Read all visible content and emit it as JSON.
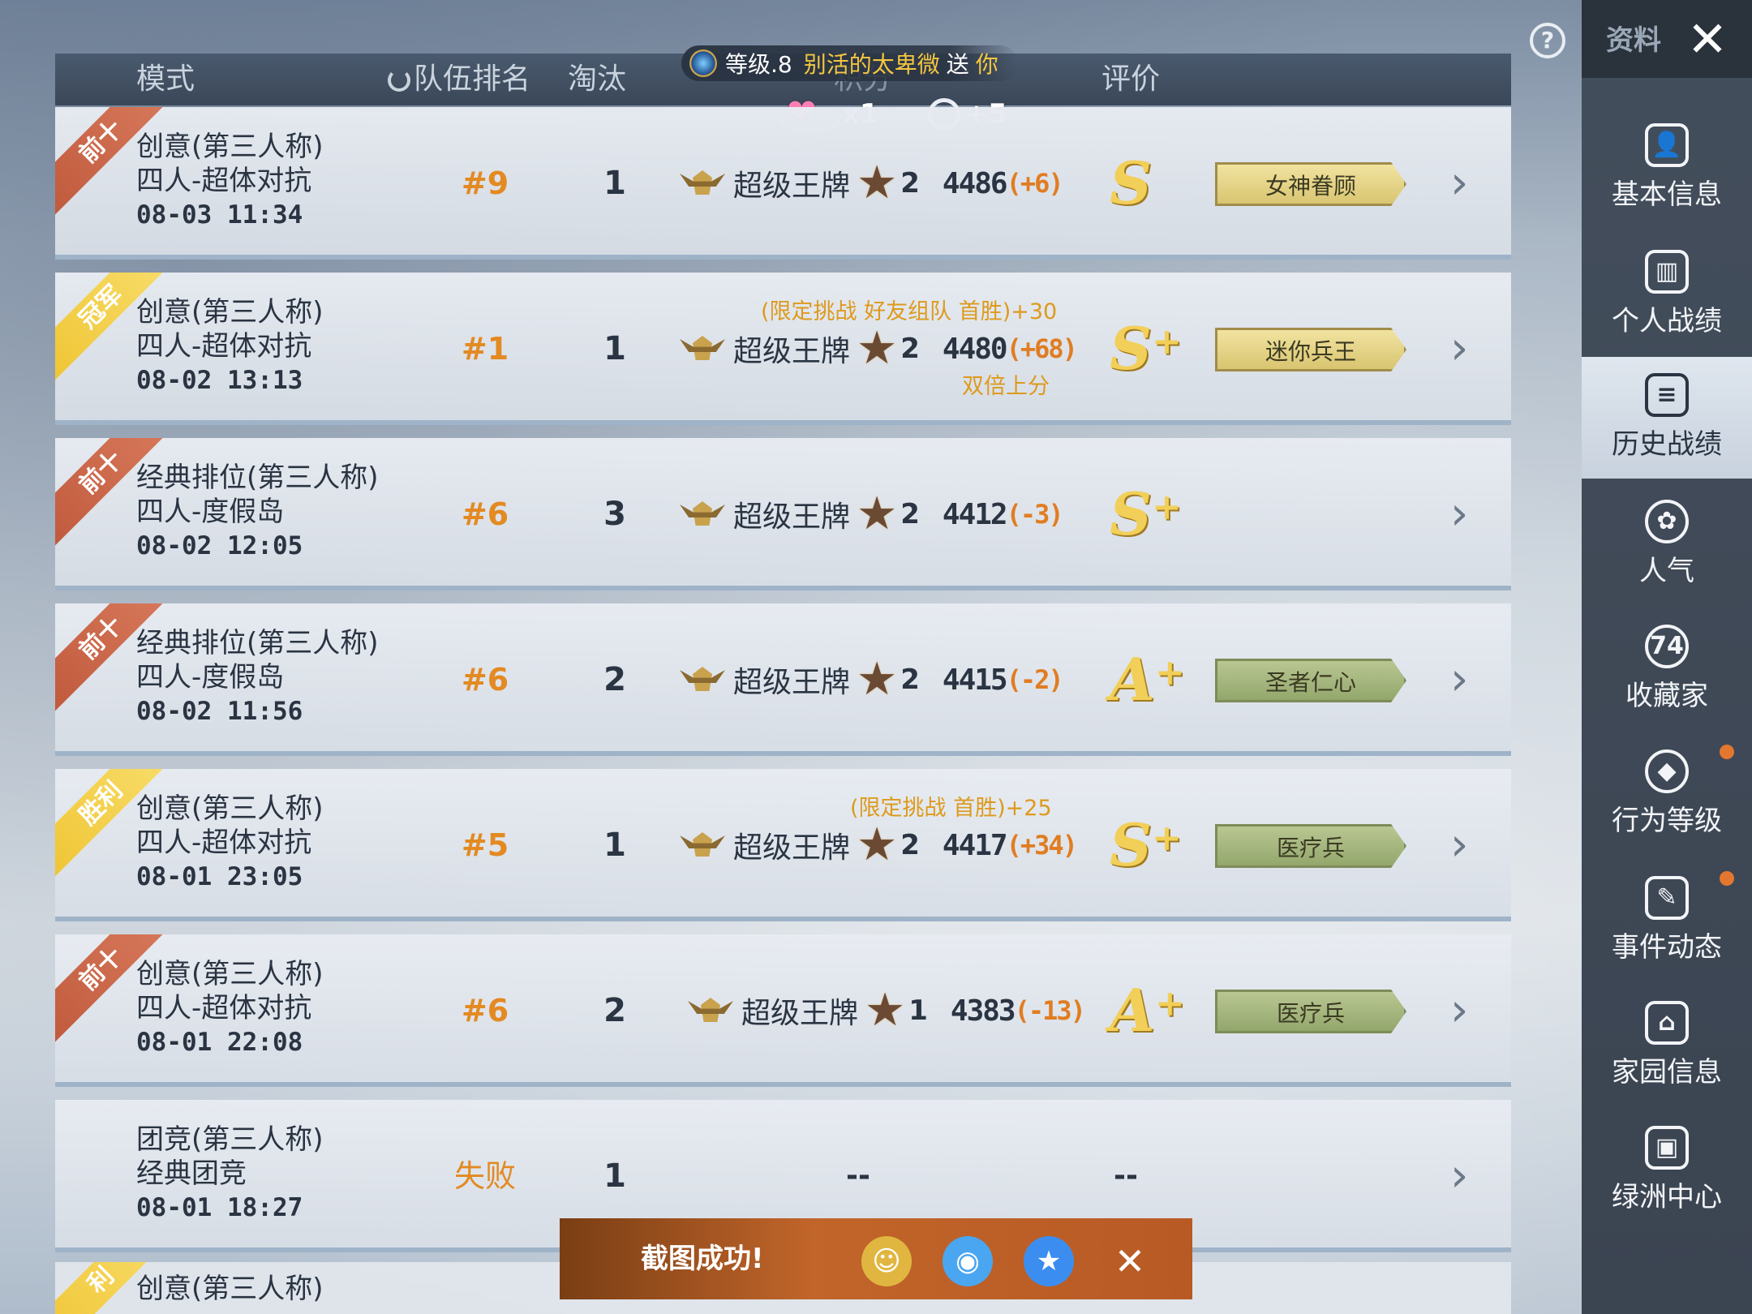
{
  "header": {
    "mode": "模式",
    "team_rank": "队伍排名",
    "eliminations": "淘汰",
    "points": "积分",
    "rating": "评价"
  },
  "notice": {
    "level": "等级.8",
    "sender": "别活的太卑微",
    "action": "送",
    "target": "你"
  },
  "gifts": {
    "heart_count": "x1",
    "rose_count": "+5"
  },
  "rows": [
    {
      "ribbon": "前十",
      "ribbon_style": "red",
      "mode": "创意(第三人称)",
      "submode": "四人-超体对抗",
      "time": "08-03 11:34",
      "rank": "#9",
      "elim": "1",
      "tier": "超级王牌",
      "tier_num": "2",
      "score": "4486",
      "delta": "(+6)",
      "note_top": "",
      "note_bottom": "",
      "grade": "S",
      "grade_plus": "",
      "badge": "女神眷顾",
      "badge_style": "gold"
    },
    {
      "ribbon": "冠军",
      "ribbon_style": "gold",
      "mode": "创意(第三人称)",
      "submode": "四人-超体对抗",
      "time": "08-02 13:13",
      "rank": "#1",
      "elim": "1",
      "tier": "超级王牌",
      "tier_num": "2",
      "score": "4480",
      "delta": "(+68)",
      "note_top": "(限定挑战 好友组队 首胜)+30",
      "note_bottom": "双倍上分",
      "grade": "S",
      "grade_plus": "+",
      "badge": "迷你兵王",
      "badge_style": "gold"
    },
    {
      "ribbon": "前十",
      "ribbon_style": "red",
      "mode": "经典排位(第三人称)",
      "submode": "四人-度假岛",
      "time": "08-02 12:05",
      "rank": "#6",
      "elim": "3",
      "tier": "超级王牌",
      "tier_num": "2",
      "score": "4412",
      "delta": "(-3)",
      "note_top": "",
      "note_bottom": "",
      "grade": "S",
      "grade_plus": "+",
      "badge": "",
      "badge_style": ""
    },
    {
      "ribbon": "前十",
      "ribbon_style": "red",
      "mode": "经典排位(第三人称)",
      "submode": "四人-度假岛",
      "time": "08-02 11:56",
      "rank": "#6",
      "elim": "2",
      "tier": "超级王牌",
      "tier_num": "2",
      "score": "4415",
      "delta": "(-2)",
      "note_top": "",
      "note_bottom": "",
      "grade": "A",
      "grade_plus": "+",
      "badge": "圣者仁心",
      "badge_style": "green"
    },
    {
      "ribbon": "胜利",
      "ribbon_style": "gold",
      "mode": "创意(第三人称)",
      "submode": "四人-超体对抗",
      "time": "08-01 23:05",
      "rank": "#5",
      "elim": "1",
      "tier": "超级王牌",
      "tier_num": "2",
      "score": "4417",
      "delta": "(+34)",
      "note_top": "(限定挑战 首胜)+25",
      "note_bottom": "",
      "grade": "S",
      "grade_plus": "+",
      "badge": "医疗兵",
      "badge_style": "green"
    },
    {
      "ribbon": "前十",
      "ribbon_style": "red",
      "mode": "创意(第三人称)",
      "submode": "四人-超体对抗",
      "time": "08-01 22:08",
      "rank": "#6",
      "elim": "2",
      "tier": "超级王牌",
      "tier_num": "1",
      "score": "4383",
      "delta": "(-13)",
      "note_top": "",
      "note_bottom": "",
      "grade": "A",
      "grade_plus": "+",
      "badge": "医疗兵",
      "badge_style": "green"
    },
    {
      "ribbon": "",
      "ribbon_style": "",
      "mode": "团竞(第三人称)",
      "submode": "经典团竞",
      "time": "08-01 18:27",
      "rank": "失败",
      "elim": "1",
      "tier": "",
      "tier_num": "",
      "score": "--",
      "delta": "",
      "note_top": "",
      "note_bottom": "",
      "grade": "--",
      "grade_plus": "",
      "badge": "",
      "badge_style": ""
    }
  ],
  "partial_row": {
    "ribbon": "利",
    "mode": "创意(第三人称)"
  },
  "sidebar": {
    "title": "资料",
    "items": [
      {
        "label": "基本信息",
        "icon": "profile-icon",
        "glyph": "👤"
      },
      {
        "label": "个人战绩",
        "icon": "stats-icon",
        "glyph": "▥"
      },
      {
        "label": "历史战绩",
        "icon": "history-icon",
        "glyph": "≡"
      },
      {
        "label": "人气",
        "icon": "rose-icon",
        "glyph": "✿"
      },
      {
        "label": "收藏家",
        "icon": "collector-icon",
        "glyph": "74"
      },
      {
        "label": "行为等级",
        "icon": "behavior-icon",
        "glyph": "◆"
      },
      {
        "label": "事件动态",
        "icon": "event-icon",
        "glyph": "✎"
      },
      {
        "label": "家园信息",
        "icon": "home-icon",
        "glyph": "⌂"
      },
      {
        "label": "绿洲中心",
        "icon": "oasis-icon",
        "glyph": "▣"
      }
    ],
    "active_index": 2
  },
  "toast": {
    "message": "截图成功!"
  }
}
